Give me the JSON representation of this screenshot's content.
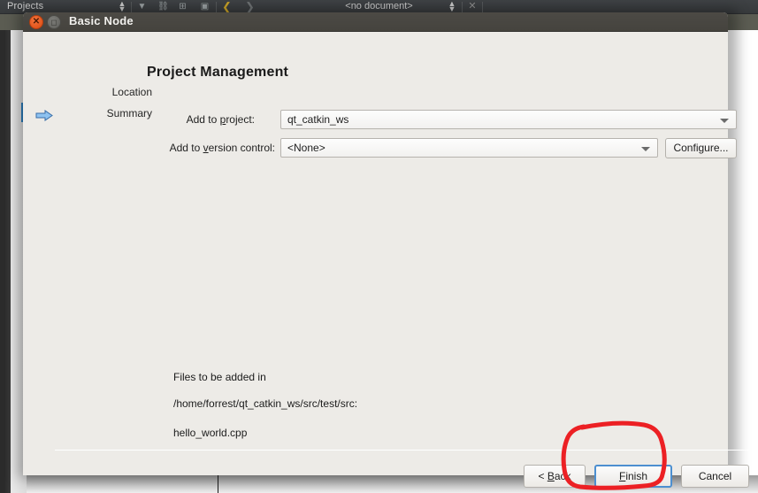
{
  "ide": {
    "panel_title": "Projects",
    "document_label": "<no document>",
    "toolbar_icons": [
      "filter-icon",
      "link-icon",
      "add-file-icon",
      "synchronize-icon",
      "back-chevron-icon",
      "forward-chevron-icon"
    ],
    "sort_icon": "sort-updown-icon",
    "close_icon": "close-icon"
  },
  "dialog": {
    "title": "Basic Node",
    "close_icon": "close-icon",
    "maximize_icon": "maximize-icon",
    "page_title": "Project Management",
    "steps": [
      {
        "label": "Location",
        "active": false,
        "arrow_icon": ""
      },
      {
        "label": "Summary",
        "active": true,
        "arrow_icon": "right-arrow-icon"
      }
    ],
    "form": {
      "project": {
        "label_pre": "Add to ",
        "label_mnemonic": "p",
        "label_post": "roject:",
        "value": "qt_catkin_ws",
        "dropdown_icon": "chevron-down-icon"
      },
      "vcs": {
        "label_pre": "Add to ",
        "label_mnemonic": "v",
        "label_post": "ersion control:",
        "value": "<None>",
        "dropdown_icon": "chevron-down-icon"
      },
      "configure_label": "Configure..."
    },
    "summary": {
      "line1": "Files to be added in",
      "line2": "/home/forrest/qt_catkin_ws/src/test/src:",
      "line3": "hello_world.cpp"
    },
    "footer": {
      "back_pre": "< ",
      "back_mnemonic": "B",
      "back_post": "ack",
      "finish_mnemonic": "F",
      "finish_post": "inish",
      "cancel_label": "Cancel"
    }
  },
  "annotation": {
    "type": "hand-drawn-circle",
    "color": "#ec2024",
    "target": "finish-button"
  },
  "colors": {
    "dialog_bg": "#edebe7",
    "titlebar": "#4c4a45",
    "accent_focus": "#4c8fd0",
    "annotation_red": "#ec2024",
    "ide_toolbar": "#3f4245",
    "scroll_thumb_blue": "#2a7ec0"
  }
}
